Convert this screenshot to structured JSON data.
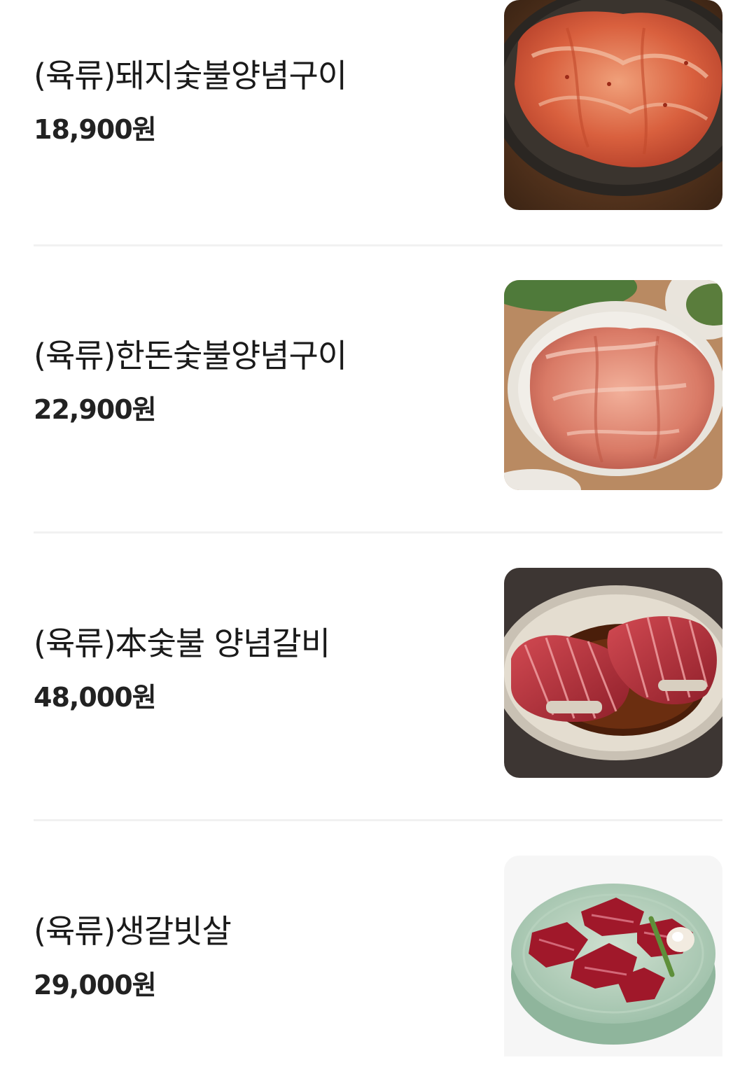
{
  "menu": {
    "items": [
      {
        "name": "(육류)돼지숯불양념구이",
        "price": "18,900원",
        "image": "marinated-pork-on-dark-plate"
      },
      {
        "name": "(육류)한돈숯불양념구이",
        "price": "22,900원",
        "image": "marinated-pork-on-white-plate"
      },
      {
        "name": "(육류)本숯불 양념갈비",
        "price": "48,000원",
        "image": "marinated-galbi-on-stone-plate"
      },
      {
        "name": "(육류)생갈빗살",
        "price": "29,000원",
        "image": "raw-rib-meat-on-green-plate"
      }
    ]
  }
}
